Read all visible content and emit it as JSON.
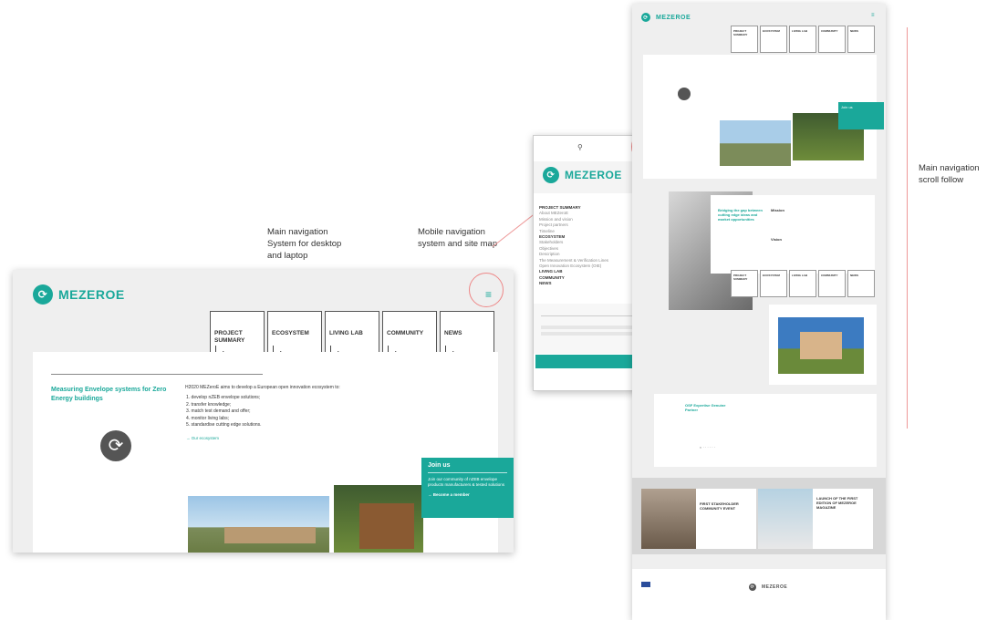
{
  "captions": {
    "desktop": "Main navigation\nSystem for desktop\nand laptop",
    "mobile": "Mobile navigation\nsystem and site map",
    "scroll": "Main navigation\nscroll follow"
  },
  "brand": {
    "name": "MEZEROE"
  },
  "desktop": {
    "nav": [
      "PROJECT SUMMARY",
      "ECOSYSTEM",
      "LIVING LAB",
      "COMMUNITY",
      "NEWS"
    ],
    "section_title": "Measuring Envelope systems for Zero Energy buildings",
    "intro": "H2020 MEZeroE aims to develop a European open innovation ecosystem to:",
    "list": [
      "1. develop nZEB envelope solutions;",
      "2. transfer knowledge;",
      "3. match test demand and offer;",
      "4. monitor living labs;",
      "5. standardise cutting edge solutions."
    ],
    "more_link": "→ Our ecosystem",
    "join_title": "Join us",
    "join_text": "Join our community of nZEB envelope products manufacturers & tested solutions",
    "join_cta": "→ Become a member"
  },
  "mobile": {
    "menu": [
      {
        "label": "PROJECT SUMMARY",
        "bold": true
      },
      {
        "label": "About MEZeroE",
        "bold": false
      },
      {
        "label": "Mission and vision",
        "bold": false
      },
      {
        "label": "Project partners",
        "bold": false
      },
      {
        "label": "Timeline",
        "bold": false
      },
      {
        "label": "ECOSYSTEM",
        "bold": true
      },
      {
        "label": "Stakeholders",
        "bold": false
      },
      {
        "label": "Objectives",
        "bold": false
      },
      {
        "label": "Description",
        "bold": false
      },
      {
        "label": "The Measurement & Verification Lines",
        "bold": false
      },
      {
        "label": "Open Innovation Ecosystem (OIE)",
        "bold": false
      },
      {
        "label": "LIVING LAB",
        "bold": true
      },
      {
        "label": "COMMUNITY",
        "bold": true
      },
      {
        "label": "NEWS",
        "bold": true
      }
    ],
    "close": "×",
    "search_icon": "search-icon"
  },
  "right": {
    "nav": [
      "PROJECT SUMMARY",
      "ECOSYSTEM",
      "LIVING LAB",
      "COMMUNITY",
      "NEWS"
    ],
    "join_title": "Join us",
    "section2_title": "Bridging the gap between cutting edge ideas and market opportunities",
    "mission_title": "Mission",
    "vision_title": "Vision",
    "news1": "FIRST STAKEHOLDER COMMUNITY EVENT",
    "news2": "LAUNCH OF THE FIRST EDITION OF MEZEROE MAGAZINE",
    "expert_title": "OSF Expertise Genuine Partner",
    "footer_brand": "MEZEROE"
  },
  "colors": {
    "accent": "#1aa89a",
    "panel": "#efefef"
  }
}
